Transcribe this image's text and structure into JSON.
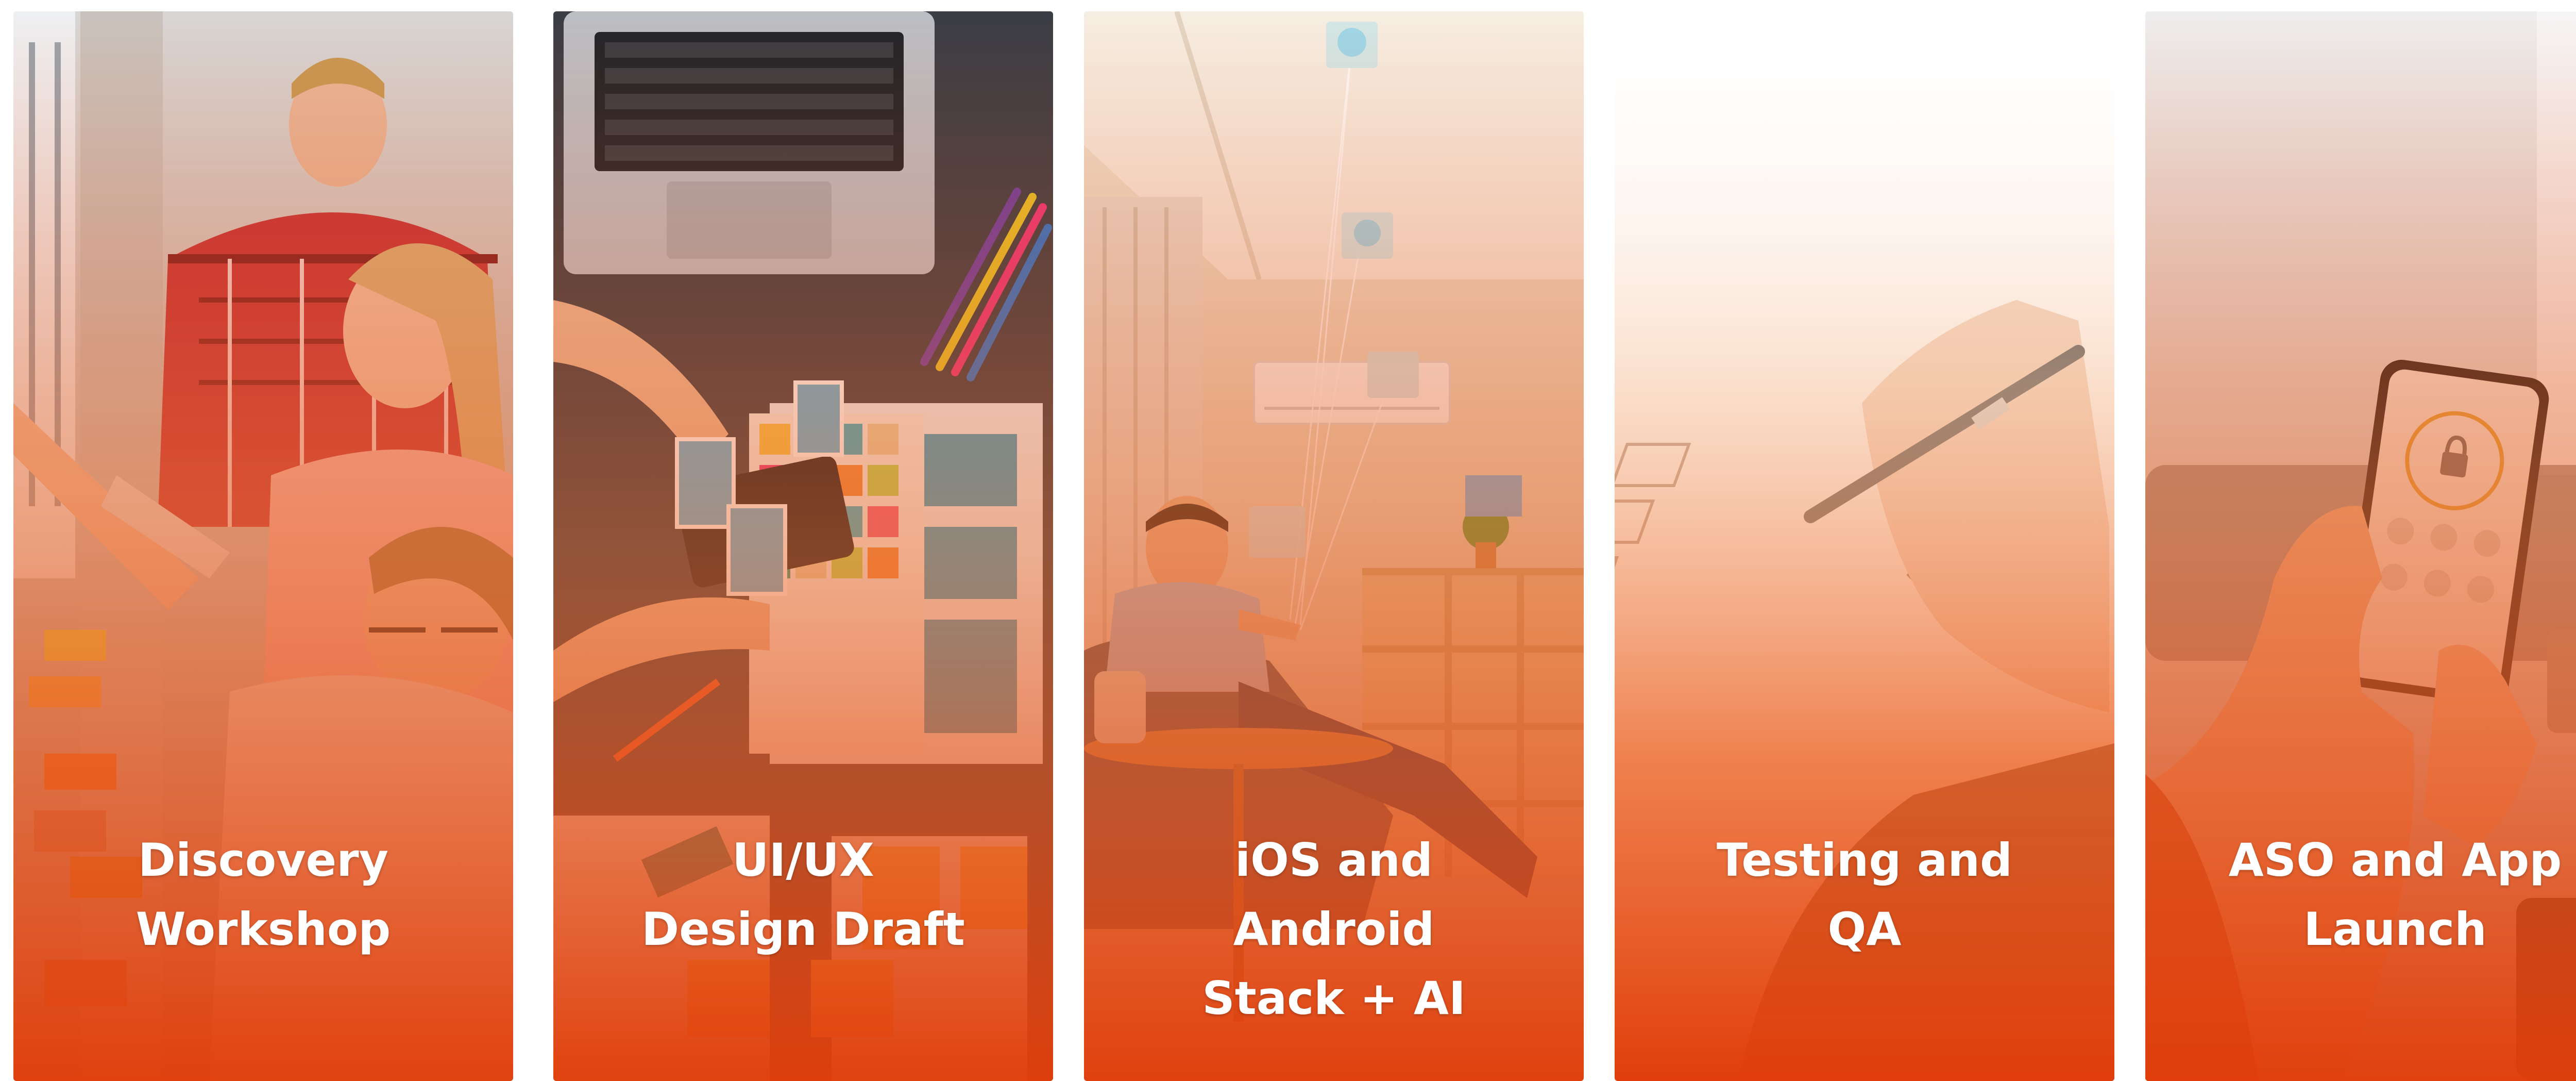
{
  "cards": [
    {
      "title_lines": [
        "Discovery",
        "Workshop"
      ],
      "image": "team-workshop-sticky-notes-photo"
    },
    {
      "title_lines": [
        "UI/UX",
        "Design Draft"
      ],
      "image": "ui-ux-wireframe-desk-photo"
    },
    {
      "title_lines": [
        "iOS and",
        "Android",
        "Stack + AI"
      ],
      "image": "man-controlling-smart-home-photo"
    },
    {
      "title_lines": [
        "Testing and",
        "QA"
      ],
      "image": "hand-checking-checklist-photo"
    },
    {
      "title_lines": [
        "ASO and App",
        "Launch"
      ],
      "image": "hand-holding-smartphone-app-photo"
    }
  ],
  "colors": {
    "accent": "#e9450f",
    "accent_dark": "#c93a0a"
  }
}
